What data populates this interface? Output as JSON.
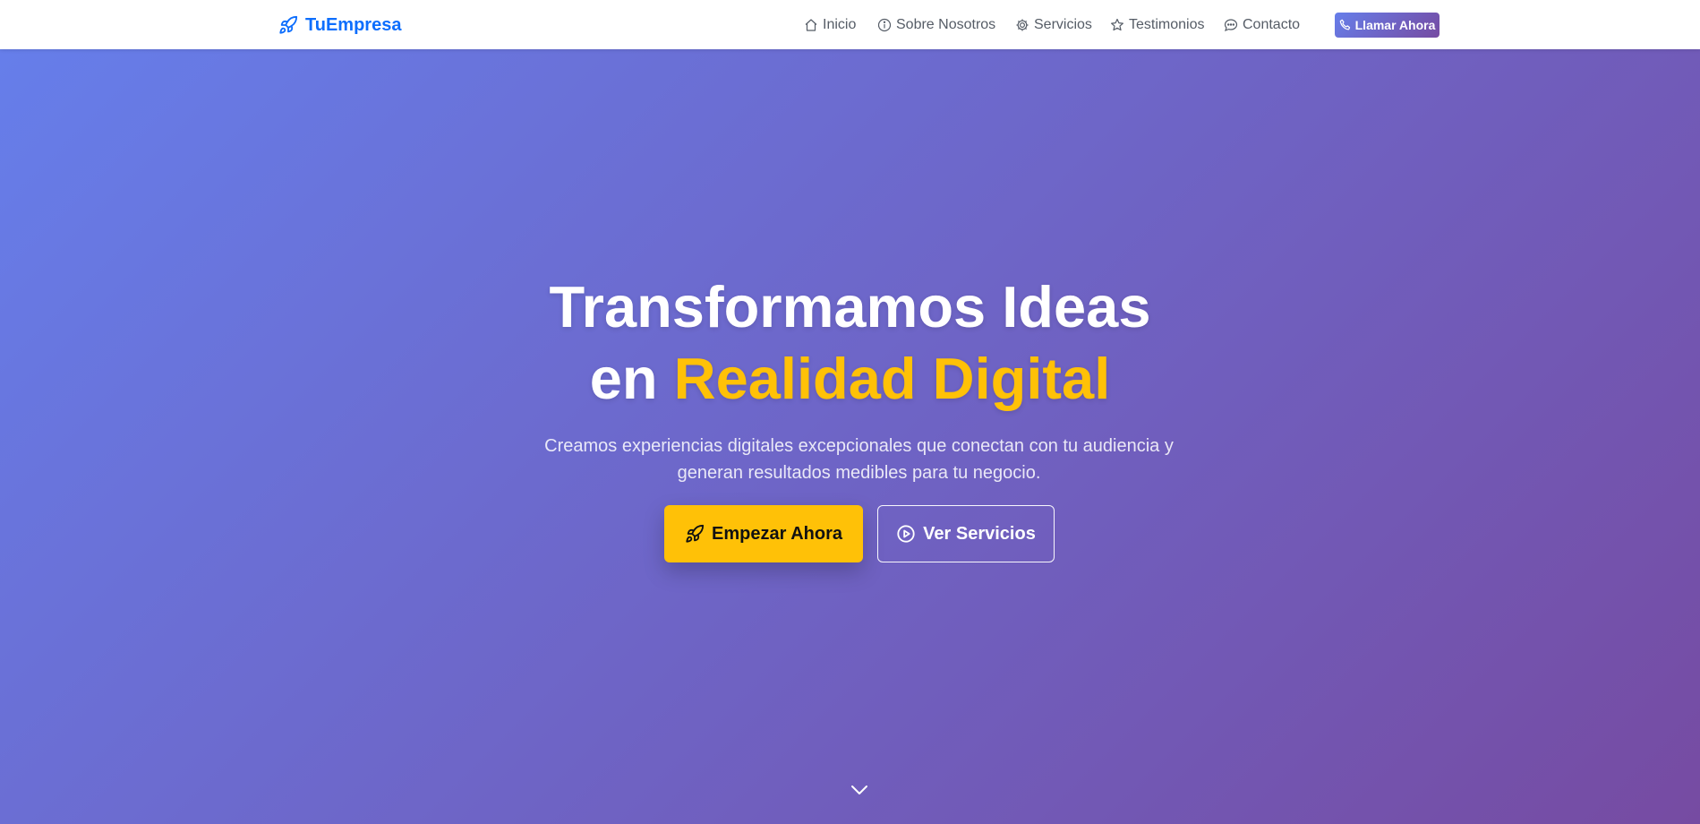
{
  "navbar": {
    "brand": {
      "label": "TuEmpresa",
      "icon": "rocket-icon"
    },
    "links": [
      {
        "label": "Inicio",
        "icon": "house-icon"
      },
      {
        "label": "Sobre Nosotros",
        "icon": "info-circle-icon"
      },
      {
        "label": "Servicios",
        "icon": "gear-icon"
      },
      {
        "label": "Testimonios",
        "icon": "star-icon"
      },
      {
        "label": "Contacto",
        "icon": "chat-dots-icon"
      }
    ],
    "call_button": {
      "label": "Llamar Ahora",
      "icon": "phone-icon"
    }
  },
  "hero": {
    "title_line1": "Transformamos Ideas",
    "title_line2_prefix": "en ",
    "title_line2_accent": "Realidad Digital",
    "subtitle": "Creamos experiencias digitales excepcionales que conectan con tu audiencia y generan resultados medibles para tu negocio.",
    "primary_button": {
      "label": "Empezar Ahora",
      "icon": "rocket-icon"
    },
    "secondary_button": {
      "label": "Ver Servicios",
      "icon": "play-circle-icon"
    },
    "scroll_icon": "chevron-down-icon"
  },
  "colors": {
    "brand": "#0d6efd",
    "gradient_start": "#667eea",
    "gradient_end": "#764ba2",
    "accent": "#ffc107",
    "nav_text": "#555c66"
  }
}
